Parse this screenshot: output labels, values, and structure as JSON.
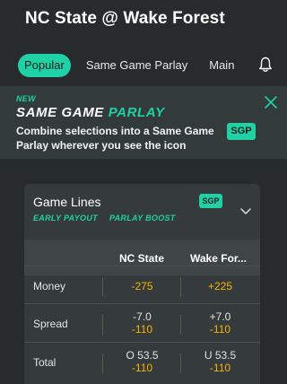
{
  "header": {
    "title": "NC State @ Wake Forest"
  },
  "tabs": [
    {
      "label": "Popular",
      "active": true
    },
    {
      "label": "Same Game Parlay",
      "active": false
    },
    {
      "label": "Main",
      "active": false
    }
  ],
  "icons": {
    "notifications": "bell-icon",
    "close": "close-icon",
    "expand": "chevron-down-icon"
  },
  "promo": {
    "new_label": "NEW",
    "title_part1": "SAME GAME ",
    "title_part2": "PARLAY",
    "description": "Combine selections into a Same Game Parlay wherever you see the icon",
    "badge": "SGP"
  },
  "game_lines": {
    "title": "Game Lines",
    "badge": "SGP",
    "tags": [
      "EARLY PAYOUT",
      "PARLAY BOOST"
    ],
    "columns": [
      "NC State",
      "Wake For..."
    ],
    "rows": [
      {
        "label": "Money",
        "away": {
          "line": "",
          "odds": "-275"
        },
        "home": {
          "line": "",
          "odds": "+225"
        }
      },
      {
        "label": "Spread",
        "away": {
          "line": "-7.0",
          "odds": "-110"
        },
        "home": {
          "line": "+7.0",
          "odds": "-110"
        }
      },
      {
        "label": "Total",
        "away": {
          "line": "O 53.5",
          "odds": "-110"
        },
        "home": {
          "line": "U 53.5",
          "odds": "-110"
        }
      }
    ]
  },
  "colors": {
    "accent": "#1fd1a5",
    "odds": "#f5b400",
    "background": "#272b2d"
  }
}
